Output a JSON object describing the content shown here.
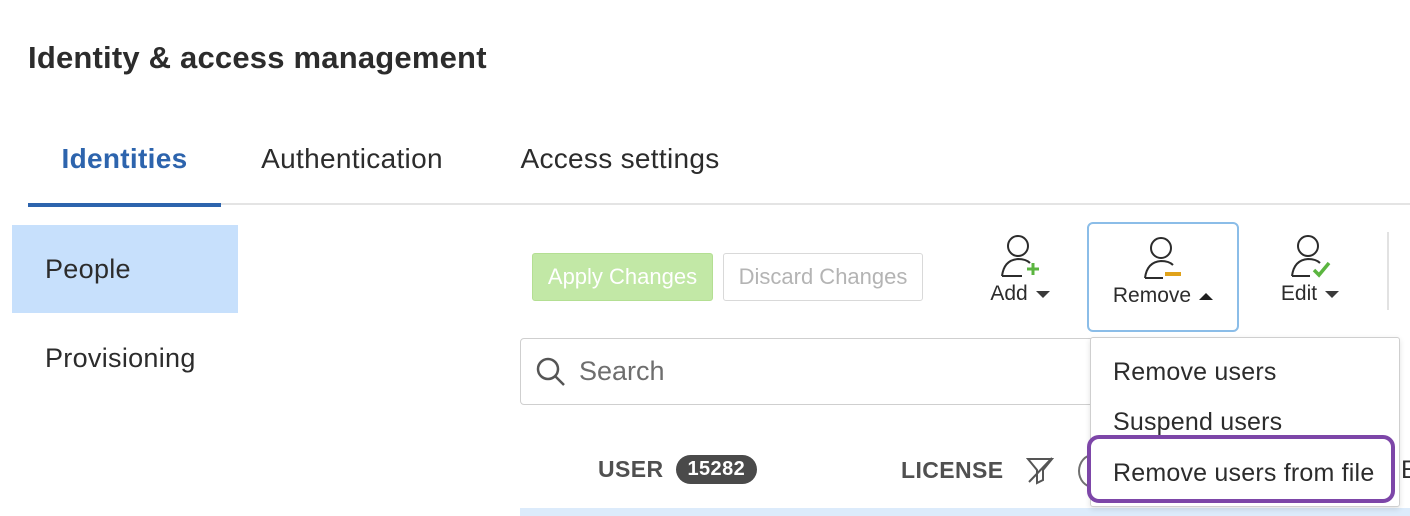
{
  "page": {
    "title": "Identity & access management"
  },
  "tabs": [
    {
      "label": "Identities",
      "active": true
    },
    {
      "label": "Authentication",
      "active": false
    },
    {
      "label": "Access settings",
      "active": false
    }
  ],
  "sidebar": {
    "items": [
      {
        "label": "People",
        "selected": true
      },
      {
        "label": "Provisioning",
        "selected": false
      }
    ]
  },
  "actions": {
    "apply_label": "Apply Changes",
    "discard_label": "Discard Changes"
  },
  "toolbar": {
    "add_label": "Add",
    "remove_label": "Remove",
    "edit_label": "Edit"
  },
  "search": {
    "placeholder": "Search"
  },
  "table": {
    "columns": [
      {
        "label": "USER",
        "count": "15282"
      },
      {
        "label": "LICENSE"
      }
    ],
    "clipped_edge_text": "E"
  },
  "remove_menu": {
    "items": [
      {
        "label": "Remove users"
      },
      {
        "label": "Suspend users"
      },
      {
        "label": "Remove users from file",
        "highlighted": true
      }
    ]
  },
  "icons": {
    "add": "add-user-icon",
    "remove": "remove-user-icon",
    "edit": "edit-user-icon",
    "search": "search-icon",
    "filter": "filter-off-icon"
  },
  "colors": {
    "accent": "#2d64ad",
    "sidebar_selected": "#c7e0fc",
    "apply_bg": "#c2e8a6",
    "add_plus": "#5bb540",
    "remove_minus": "#e0a21a",
    "edit_check": "#5bb540",
    "highlight_ring": "#7d46a8"
  }
}
